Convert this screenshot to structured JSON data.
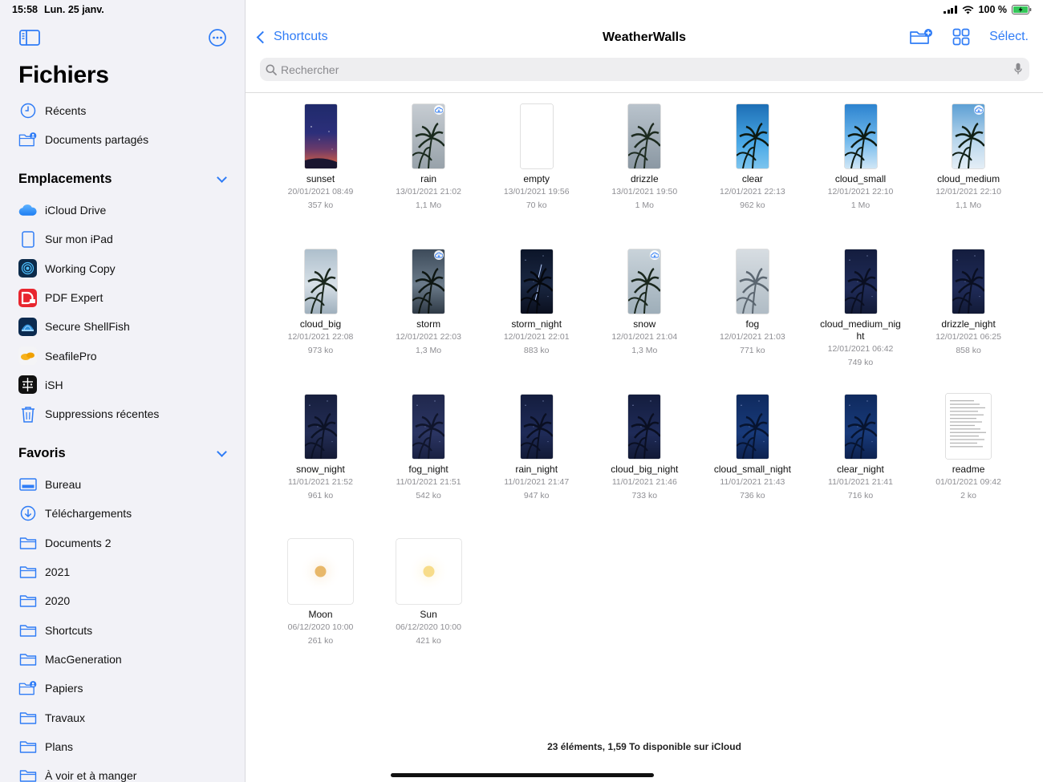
{
  "status": {
    "time": "15:58",
    "date": "Lun. 25 janv.",
    "battery": "100 %"
  },
  "sidebar": {
    "title": "Fichiers",
    "top": [
      {
        "label": "Récents",
        "icon": "clock-icon"
      },
      {
        "label": "Documents partagés",
        "icon": "shared-folder-icon"
      }
    ],
    "locations_title": "Emplacements",
    "locations": [
      {
        "label": "iCloud Drive",
        "icon": "icloud-icon"
      },
      {
        "label": "Sur mon iPad",
        "icon": "ipad-icon"
      },
      {
        "label": "Working Copy",
        "icon": "working-copy-icon"
      },
      {
        "label": "PDF Expert",
        "icon": "pdf-expert-icon"
      },
      {
        "label": "Secure ShellFish",
        "icon": "shellfish-icon"
      },
      {
        "label": "SeafilePro",
        "icon": "seafile-icon"
      },
      {
        "label": "iSH",
        "icon": "ish-icon"
      },
      {
        "label": "Suppressions récentes",
        "icon": "trash-icon"
      }
    ],
    "favorites_title": "Favoris",
    "favorites": [
      {
        "label": "Bureau",
        "icon": "desktop-folder-icon"
      },
      {
        "label": "Téléchargements",
        "icon": "download-icon"
      },
      {
        "label": "Documents 2",
        "icon": "folder-icon"
      },
      {
        "label": "2021",
        "icon": "folder-icon"
      },
      {
        "label": "2020",
        "icon": "folder-icon"
      },
      {
        "label": "Shortcuts",
        "icon": "folder-icon"
      },
      {
        "label": "MacGeneration",
        "icon": "folder-icon"
      },
      {
        "label": "Papiers",
        "icon": "shared-folder-icon"
      },
      {
        "label": "Travaux",
        "icon": "folder-icon"
      },
      {
        "label": "Plans",
        "icon": "folder-icon"
      },
      {
        "label": "À voir et à manger",
        "icon": "folder-icon"
      }
    ]
  },
  "header": {
    "back_label": "Shortcuts",
    "title": "WeatherWalls",
    "select_label": "Sélect.",
    "search_placeholder": "Rechercher"
  },
  "files": [
    {
      "name": "sunset",
      "date": "20/01/2021 08:49",
      "size": "357 ko",
      "kind": "sunset",
      "cloud": false
    },
    {
      "name": "rain",
      "date": "13/01/2021 21:02",
      "size": "1,1 Mo",
      "kind": "rain",
      "cloud": true
    },
    {
      "name": "empty",
      "date": "13/01/2021 19:56",
      "size": "70 ko",
      "kind": "empty",
      "cloud": false
    },
    {
      "name": "drizzle",
      "date": "13/01/2021 19:50",
      "size": "1 Mo",
      "kind": "drizzle",
      "cloud": false
    },
    {
      "name": "clear",
      "date": "12/01/2021 22:13",
      "size": "962 ko",
      "kind": "clear",
      "cloud": false
    },
    {
      "name": "cloud_small",
      "date": "12/01/2021 22:10",
      "size": "1 Mo",
      "kind": "cloudsmall",
      "cloud": false
    },
    {
      "name": "cloud_medium",
      "date": "12/01/2021 22:10",
      "size": "1,1 Mo",
      "kind": "cloudmedium",
      "cloud": true
    },
    {
      "name": "cloud_big",
      "date": "12/01/2021 22:08",
      "size": "973 ko",
      "kind": "cloudbig",
      "cloud": false
    },
    {
      "name": "storm",
      "date": "12/01/2021 22:03",
      "size": "1,3 Mo",
      "kind": "storm",
      "cloud": true
    },
    {
      "name": "storm_night",
      "date": "12/01/2021 22:01",
      "size": "883 ko",
      "kind": "stormnight",
      "cloud": false
    },
    {
      "name": "snow",
      "date": "12/01/2021 21:04",
      "size": "1,3 Mo",
      "kind": "snow",
      "cloud": true
    },
    {
      "name": "fog",
      "date": "12/01/2021 21:03",
      "size": "771 ko",
      "kind": "fog",
      "cloud": false
    },
    {
      "name": "cloud_medium_nig ht",
      "date": "12/01/2021 06:42",
      "size": "749 ko",
      "kind": "night",
      "cloud": false
    },
    {
      "name": "drizzle_night",
      "date": "12/01/2021 06:25",
      "size": "858 ko",
      "kind": "night",
      "cloud": false
    },
    {
      "name": "snow_night",
      "date": "11/01/2021 21:52",
      "size": "961 ko",
      "kind": "snownight",
      "cloud": false
    },
    {
      "name": "fog_night",
      "date": "11/01/2021 21:51",
      "size": "542 ko",
      "kind": "fognight",
      "cloud": false
    },
    {
      "name": "rain_night",
      "date": "11/01/2021 21:47",
      "size": "947 ko",
      "kind": "night",
      "cloud": false
    },
    {
      "name": "cloud_big_night",
      "date": "11/01/2021 21:46",
      "size": "733 ko",
      "kind": "night",
      "cloud": false
    },
    {
      "name": "cloud_small_night",
      "date": "11/01/2021 21:43",
      "size": "736 ko",
      "kind": "clearnight",
      "cloud": false
    },
    {
      "name": "clear_night",
      "date": "11/01/2021 21:41",
      "size": "716 ko",
      "kind": "clearnight",
      "cloud": false
    },
    {
      "name": "readme",
      "date": "01/01/2021 09:42",
      "size": "2 ko",
      "kind": "doc",
      "cloud": false
    },
    {
      "name": "Moon",
      "date": "06/12/2020 10:00",
      "size": "261 ko",
      "kind": "moon",
      "cloud": false
    },
    {
      "name": "Sun",
      "date": "06/12/2020 10:00",
      "size": "421 ko",
      "kind": "sun",
      "cloud": false
    }
  ],
  "footer": "23 éléments, 1,59 To disponible sur iCloud",
  "colors": {
    "accent": "#2f7cf6",
    "sidebar_bg": "#f2f2f7",
    "secondary_text": "#8e8e93"
  }
}
